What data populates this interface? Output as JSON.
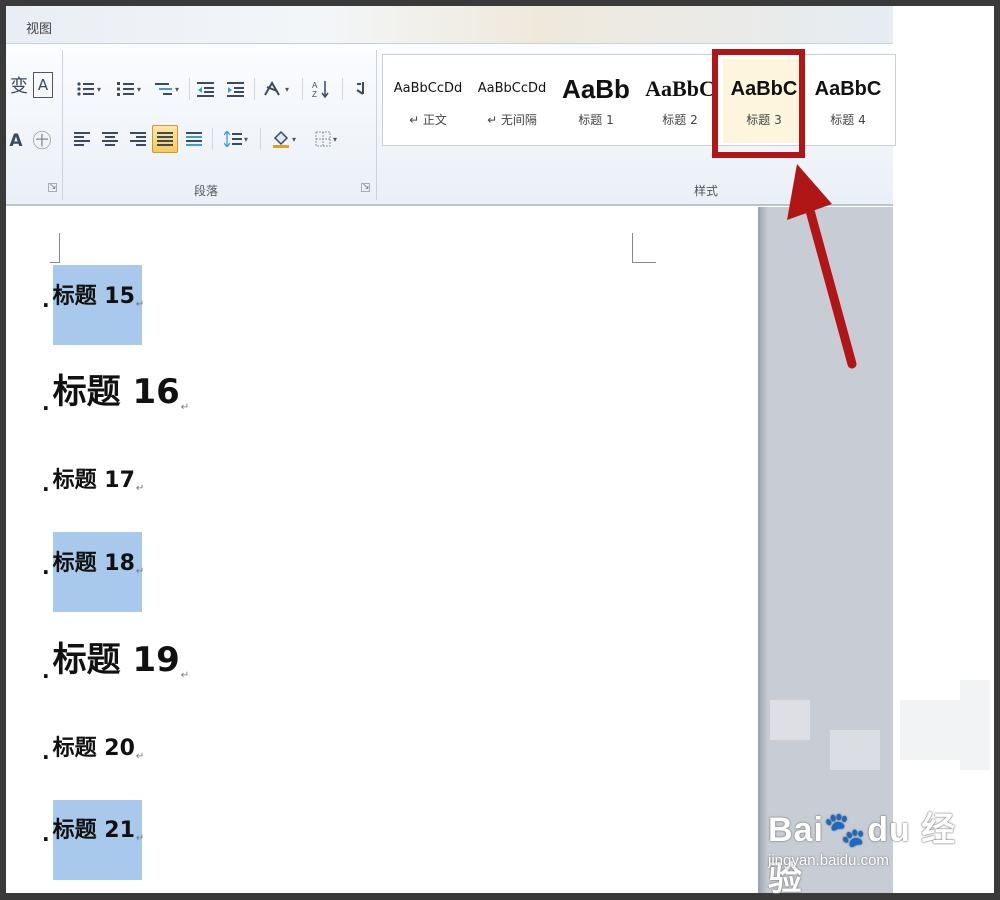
{
  "ribbon": {
    "tab": "视图",
    "paragraph_group_label": "段落",
    "styles_group_label": "样式",
    "left_partial_chars": [
      "变",
      "A",
      "A",
      "㊉"
    ],
    "styles": [
      {
        "sample": "AaBbCcDd",
        "name": "↵ 正文"
      },
      {
        "sample": "AaBbCcDd",
        "name": "↵ 无间隔"
      },
      {
        "sample": "AaBb",
        "name": "标题 1"
      },
      {
        "sample": "AaBbC",
        "name": "标题 2"
      },
      {
        "sample": "AaBbC",
        "name": "标题 3",
        "selected": true
      },
      {
        "sample": "AaBbC",
        "name": "标题 4"
      }
    ]
  },
  "document": {
    "headings": [
      {
        "text": "标题 15",
        "size": "small",
        "highlighted": true
      },
      {
        "text": "标题 16",
        "size": "big",
        "highlighted": false
      },
      {
        "text": "标题 17",
        "size": "small",
        "highlighted": false
      },
      {
        "text": "标题 18",
        "size": "small",
        "highlighted": true
      },
      {
        "text": "标题 19",
        "size": "big",
        "highlighted": false
      },
      {
        "text": "标题 20",
        "size": "small",
        "highlighted": false
      },
      {
        "text": "标题 21",
        "size": "small",
        "highlighted": true
      }
    ],
    "paragraph_mark": "↵"
  },
  "annotation": {
    "color": "#b11616"
  },
  "watermark": {
    "logo": "Bai🐾du 经验",
    "url": "jingyan.baidu.com"
  },
  "colors": {
    "selection": "#a9c9ec",
    "active_button": "#f7c95a",
    "frame": "#3a3a3a"
  }
}
